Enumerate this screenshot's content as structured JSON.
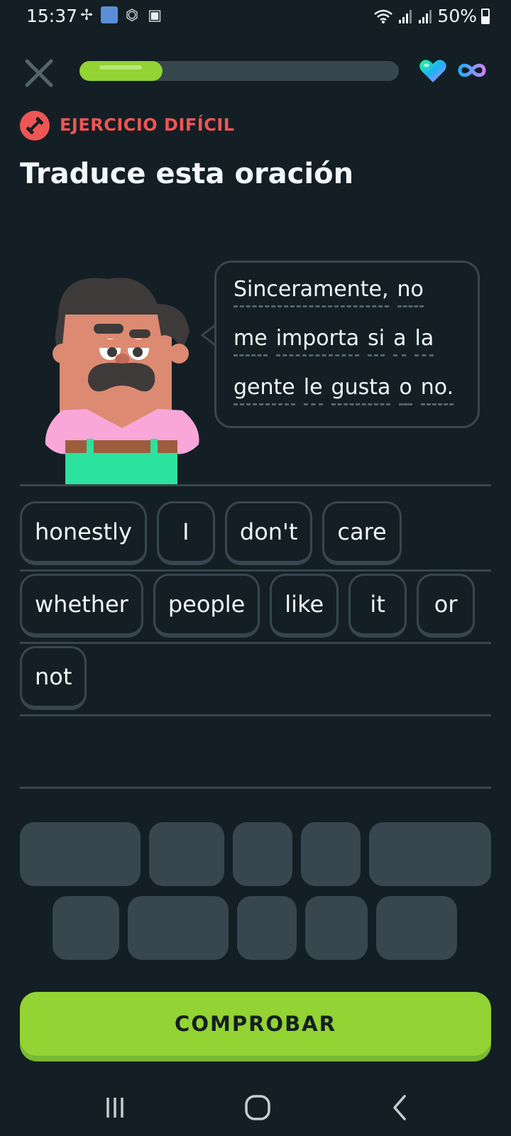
{
  "status_bar": {
    "time": "15:37",
    "battery": "50%",
    "left_icons": [
      "pinwheel-icon",
      "app-thumbnail-icon",
      "alarm-icon",
      "gallery-icon"
    ],
    "right_icons": [
      "wifi-icon",
      "signal-icon",
      "signal-icon-2",
      "battery-icon"
    ]
  },
  "lesson": {
    "progress": 0.26,
    "hearts": "infinite",
    "difficulty_label": "EJERCICIO DIFÍCIL",
    "title": "Traduce esta oración"
  },
  "prompt": {
    "lines": [
      [
        "Sinceramente,",
        "no"
      ],
      [
        "me",
        "importa",
        "si",
        "a",
        "la"
      ],
      [
        "gente",
        "le",
        "gusta",
        "o",
        "no."
      ]
    ]
  },
  "answer": {
    "rows": [
      [
        "honestly",
        "I",
        "don't",
        "care"
      ],
      [
        "whether",
        "people",
        "like",
        "it",
        "or"
      ],
      [
        "not"
      ]
    ]
  },
  "word_bank": {
    "slot_count": 10
  },
  "check_button": {
    "label": "COMPROBAR"
  },
  "colors": {
    "background": "#131f24",
    "accent_green": "#93d333",
    "hard_red": "#ee5555",
    "tile_border": "#37464f"
  }
}
